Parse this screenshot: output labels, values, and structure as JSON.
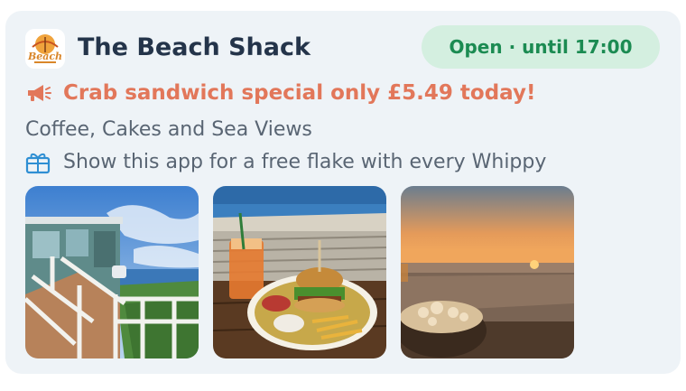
{
  "venue": {
    "name": "The Beach Shack",
    "logo_text": "Beach",
    "status": "Open · until 17:00",
    "promo": "Crab sandwich special only £5.49 today!",
    "tagline": "Coffee, Cakes and Sea Views",
    "perk": "Show this app for a free flake with every Whippy"
  },
  "icons": {
    "promo": "megaphone-icon",
    "perk": "gift-icon"
  },
  "colors": {
    "title": "#24344a",
    "status_text": "#1b8b52",
    "status_bg": "#d4efe0",
    "promo": "#e2775a",
    "body_text": "#596573",
    "card_bg": "#eef3f7"
  },
  "photos": [
    {
      "subject": "beach-hut-stairs"
    },
    {
      "subject": "burger-and-drink-by-sea"
    },
    {
      "subject": "sunset-over-beach"
    }
  ]
}
